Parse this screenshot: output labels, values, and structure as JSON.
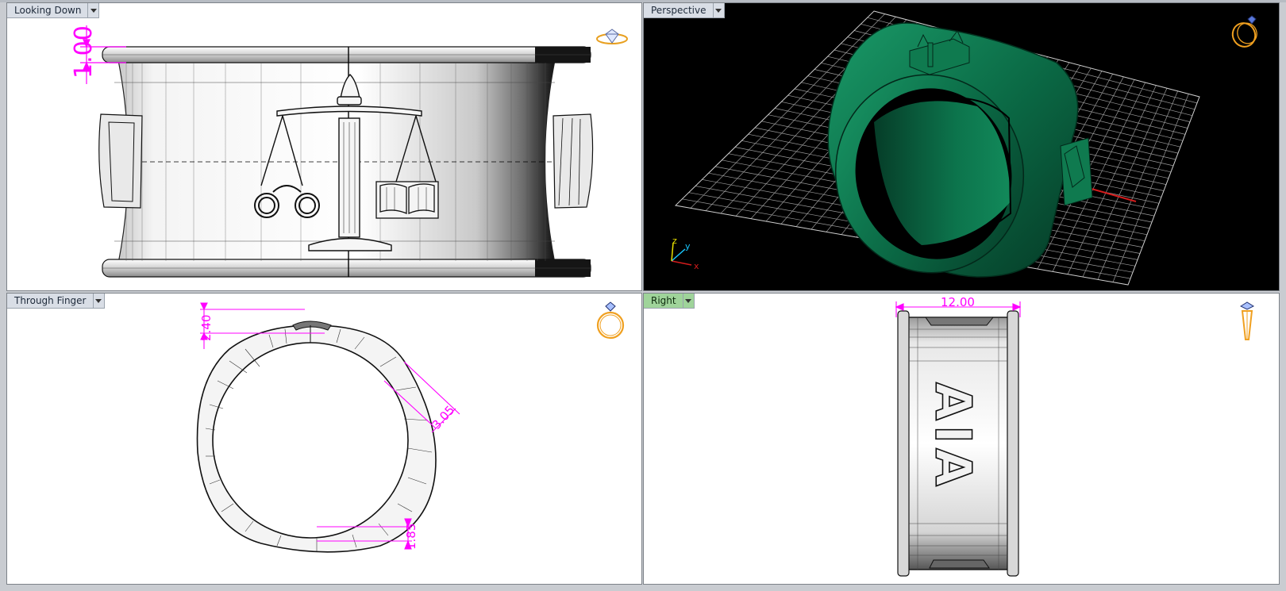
{
  "viewports": {
    "looking_down": {
      "title": "Looking Down",
      "dimension": "1.00"
    },
    "perspective": {
      "title": "Perspective",
      "axis_x": "x",
      "axis_y": "y",
      "axis_z": "z"
    },
    "through_finger": {
      "title": "Through Finger",
      "dim_top": "2.40",
      "dim_side": "3.05",
      "dim_bottom": "1.85"
    },
    "right": {
      "title": "Right",
      "dim_width": "12.00",
      "engraving": "AIA"
    }
  },
  "colors": {
    "dimension": "#ff00ff",
    "ring_green": "#0b6b46",
    "active_tab": "#9fd49a",
    "gizmo": "#f0a020"
  },
  "icons": [
    "ring-gem-icon",
    "ring-perspective-icon",
    "ring-front-icon",
    "ring-side-icon",
    "dropdown-arrow-icon"
  ]
}
